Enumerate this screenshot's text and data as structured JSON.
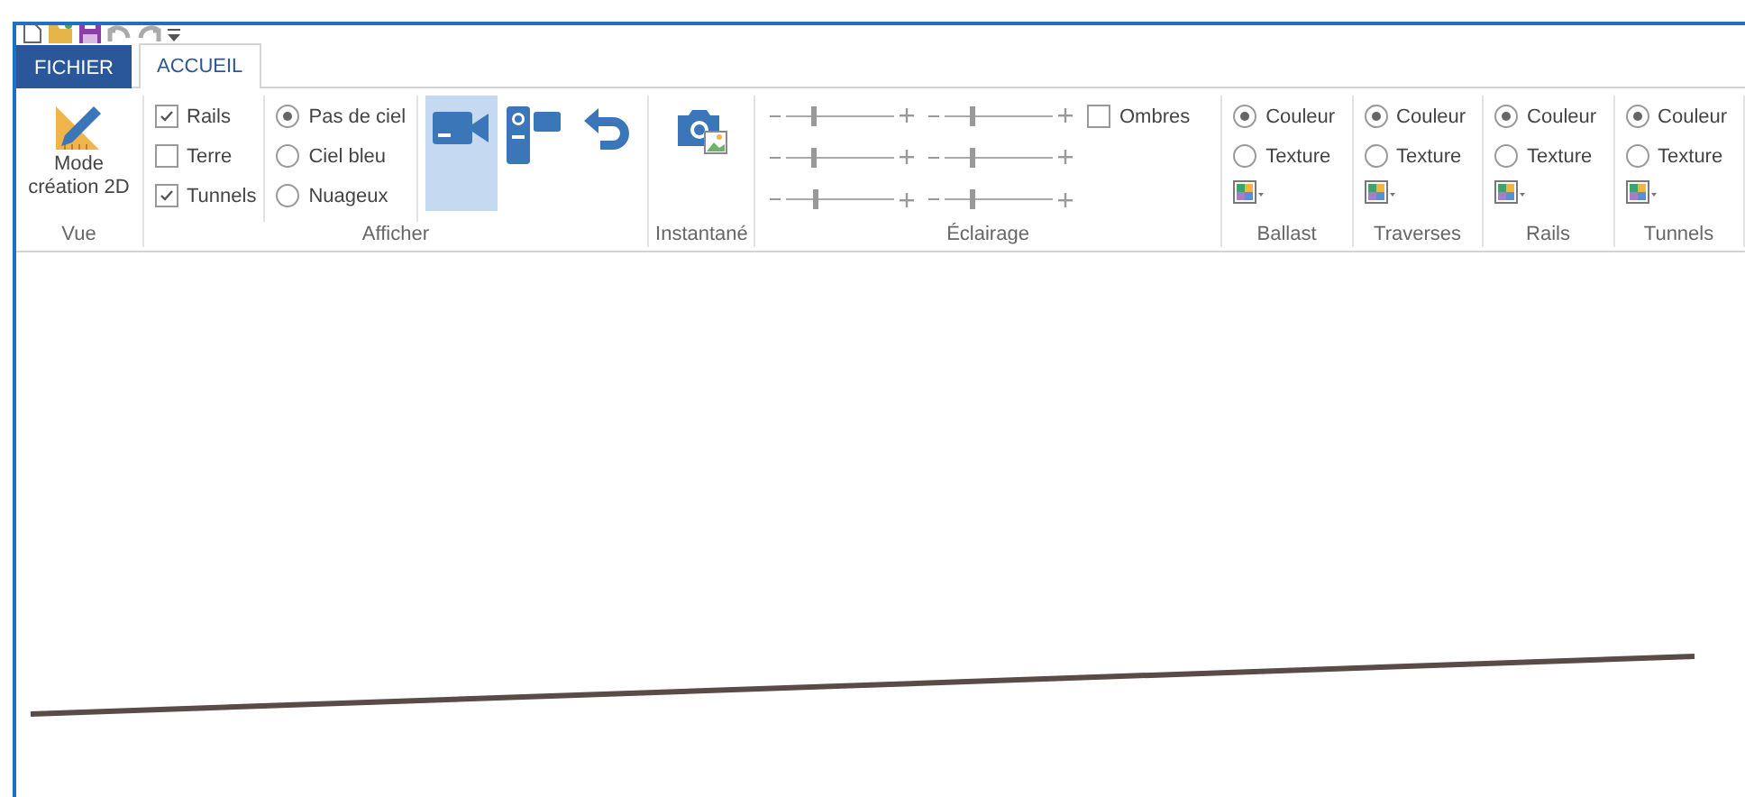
{
  "tabs": [
    {
      "label": "FICHIER",
      "kind": "file",
      "selected": false
    },
    {
      "label": "ACCUEIL",
      "kind": "tab",
      "selected": true
    }
  ],
  "ribbon": {
    "vue": {
      "button": "Mode\ncréation 2D",
      "title": "Vue"
    },
    "afficher": {
      "title": "Afficher",
      "checkboxes": [
        {
          "label": "Rails",
          "checked": true
        },
        {
          "label": "Terre",
          "checked": false
        },
        {
          "label": "Tunnels",
          "checked": true
        }
      ],
      "sky": [
        {
          "label": "Pas de ciel",
          "selected": true
        },
        {
          "label": "Ciel bleu",
          "selected": false
        },
        {
          "label": "Nuageux",
          "selected": false
        }
      ],
      "view_buttons": [
        {
          "kind": "camera",
          "selected": true
        },
        {
          "kind": "camcorder",
          "selected": false
        },
        {
          "kind": "back",
          "selected": false
        }
      ]
    },
    "instantane": {
      "title": "Instantané"
    },
    "eclairage": {
      "title": "Éclairage",
      "sliders": [
        {
          "level": 0.25
        },
        {
          "level": 0.25
        },
        {
          "level": 0.25
        },
        {
          "level": 0.25
        },
        {
          "level": 0.27
        },
        {
          "level": 0.25
        }
      ],
      "shadows": {
        "label": "Ombres",
        "checked": false
      }
    },
    "materials": [
      {
        "title": "Ballast",
        "options": [
          {
            "label": "Couleur",
            "selected": true
          },
          {
            "label": "Texture",
            "selected": false
          }
        ]
      },
      {
        "title": "Traverses",
        "options": [
          {
            "label": "Couleur",
            "selected": true
          },
          {
            "label": "Texture",
            "selected": false
          }
        ]
      },
      {
        "title": "Rails",
        "options": [
          {
            "label": "Couleur",
            "selected": true
          },
          {
            "label": "Texture",
            "selected": false
          }
        ]
      },
      {
        "title": "Tunnels",
        "options": [
          {
            "label": "Couleur",
            "selected": true
          },
          {
            "label": "Texture",
            "selected": false
          }
        ]
      }
    ]
  }
}
